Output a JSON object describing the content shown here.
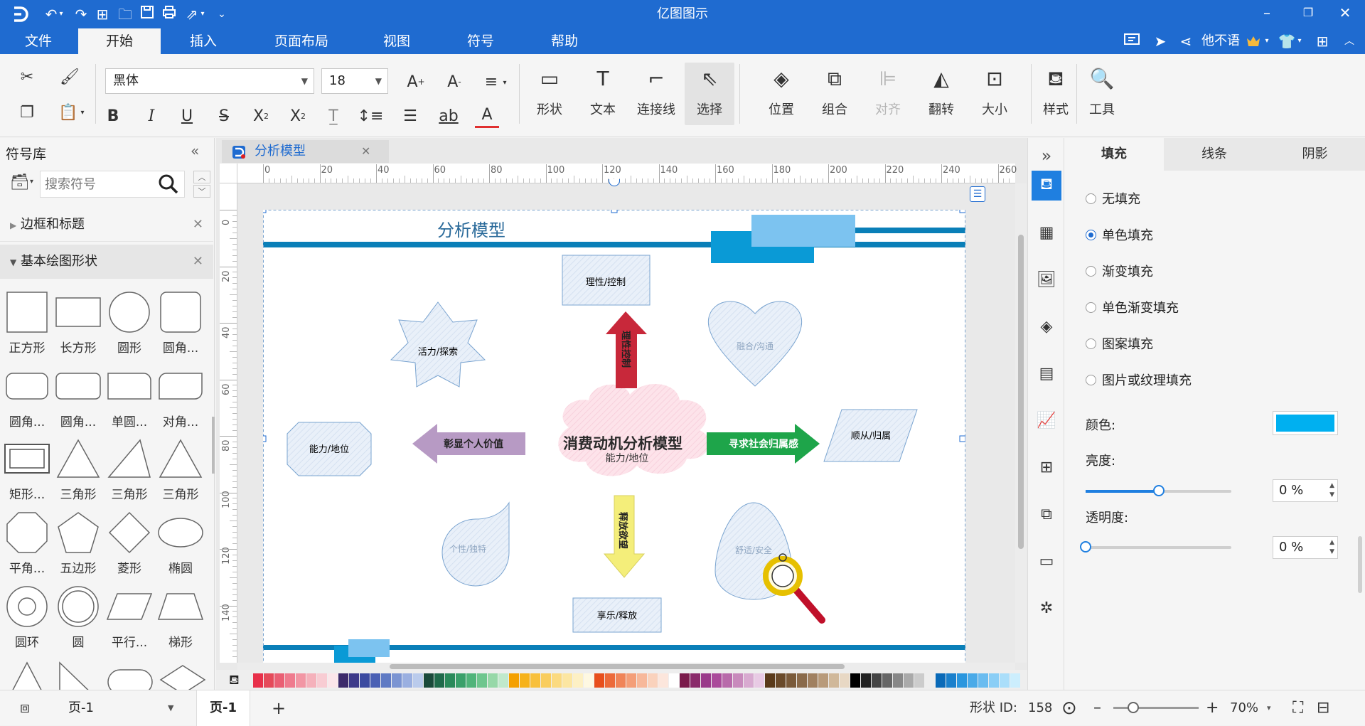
{
  "app_title": "亿图图示",
  "menu": [
    "文件",
    "开始",
    "插入",
    "页面布局",
    "视图",
    "符号",
    "帮助"
  ],
  "menu_active": "开始",
  "user_name": "他不语",
  "ribbon": {
    "font_name": "黑体",
    "font_size": "18",
    "big_buttons": [
      {
        "label": "形状",
        "icon": "rectangle-shape-icon"
      },
      {
        "label": "文本",
        "icon": "text-T-icon"
      },
      {
        "label": "连接线",
        "icon": "connector-icon"
      },
      {
        "label": "选择",
        "icon": "pointer-select-icon"
      },
      {
        "label": "位置",
        "icon": "layers-position-icon"
      },
      {
        "label": "组合",
        "icon": "group-icon"
      },
      {
        "label": "对齐",
        "icon": "align-icon"
      },
      {
        "label": "翻转",
        "icon": "flip-icon"
      },
      {
        "label": "大小",
        "icon": "size-icon"
      },
      {
        "label": "样式",
        "icon": "paint-bucket-icon"
      },
      {
        "label": "工具",
        "icon": "tools-icon"
      }
    ]
  },
  "left_panel": {
    "title": "符号库",
    "search_placeholder": "搜索符号",
    "categories": [
      "边框和标题",
      "基本绘图形状"
    ],
    "shapes": [
      "正方形",
      "长方形",
      "圆形",
      "圆角...",
      "圆角...",
      "圆角...",
      "单圆...",
      "对角...",
      "矩形...",
      "三角形",
      "三角形",
      "三角形",
      "平角...",
      "五边形",
      "菱形",
      "椭圆",
      "圆环",
      "圆",
      "平行...",
      "梯形"
    ]
  },
  "document": {
    "tab_title": "分析模型",
    "h_ruler_ticks": [
      "0",
      "20",
      "40",
      "60",
      "80",
      "100",
      "120",
      "140",
      "160",
      "180",
      "200",
      "220",
      "240",
      "260"
    ],
    "v_ruler_ticks": [
      "0",
      "20",
      "40",
      "60",
      "80",
      "100",
      "120",
      "140"
    ],
    "canvas": {
      "title": "分析模型",
      "center_title": "消费动机分析模型",
      "center_sub": "能力/地位",
      "nodes": {
        "top": "理性/控制",
        "star": "活力/探索",
        "heart": "融合/沟通",
        "left": "能力/地位",
        "right": "顺从/归属",
        "drop_left": "个性/独特",
        "drop_right": "舒适/安全",
        "bottom": "享乐/释放"
      },
      "arrows": {
        "up": "理性控制",
        "left": "彰显个人价值",
        "right": "寻求社会归属感",
        "down": "释放欲望"
      },
      "colors": {
        "top_band": "#0a7fb8",
        "rect_light": "#7cc3f0",
        "rect_mid": "#0a9ad6",
        "arrow_red": "#c8283a",
        "arrow_purple": "#b79ac4",
        "arrow_green": "#1ea54a",
        "arrow_yellow": "#f4ee7a",
        "cloud": "#fde0e8",
        "node_fill": "#e6eef8",
        "node_border": "#7aa4d0"
      }
    }
  },
  "right_panel": {
    "tabs": [
      "填充",
      "线条",
      "阴影"
    ],
    "active_tab": "填充",
    "fill_options": [
      "无填充",
      "单色填充",
      "渐变填充",
      "单色渐变填充",
      "图案填充",
      "图片或纹理填充"
    ],
    "selected_option": "单色填充",
    "color_label": "颜色:",
    "fill_color": "#00b0f0",
    "brightness_label": "亮度:",
    "brightness_value": "0 %",
    "brightness_level": 0.5,
    "transparency_label": "透明度:",
    "transparency_value": "0 %",
    "transparency_level": 0
  },
  "status": {
    "page_selector": "页-1",
    "page_tab": "页-1",
    "add_page": "+",
    "shape_id_label": "形状 ID:",
    "shape_id": "158",
    "zoom": "70%"
  }
}
